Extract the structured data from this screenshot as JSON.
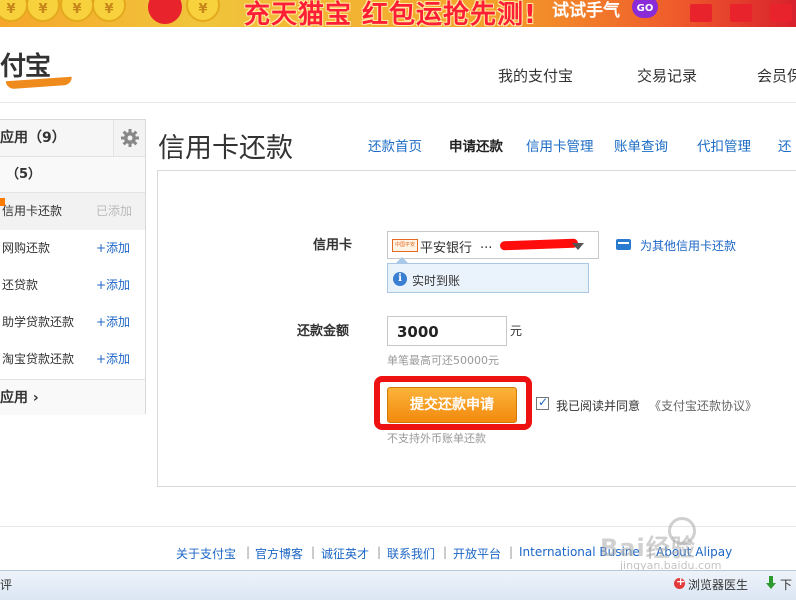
{
  "banner": {
    "headline": "充天猫宝 红包运抢先测!",
    "cta": "试试手气",
    "go": "GO"
  },
  "header": {
    "logo_text": "付宝",
    "nav": [
      "我的支付宝",
      "交易记录",
      "会员保"
    ]
  },
  "sidebar": {
    "title": "应用（9）",
    "subtitle": "（5）",
    "items": [
      {
        "label": "信用卡还款",
        "action": "已添加"
      },
      {
        "label": "网购还款",
        "action": "+添加"
      },
      {
        "label": "还贷款",
        "action": "+添加"
      },
      {
        "label": "助学贷款还款",
        "action": "+添加"
      },
      {
        "label": "淘宝贷款还款",
        "action": "+添加"
      }
    ],
    "footer": "应用"
  },
  "main": {
    "title": "信用卡还款",
    "tabs": [
      "还款首页",
      "申请还款",
      "信用卡管理",
      "账单查询",
      "代扣管理",
      "还"
    ],
    "active_tab": 1
  },
  "form": {
    "card_label": "信用卡",
    "bank_logo_text": "中国平安",
    "bank_name": "平安银行",
    "card_number": "...",
    "other_card_link": "为其他信用卡还款",
    "tip_text": "实时到账",
    "amount_label": "还款金额",
    "amount_value": "3000",
    "unit": "元",
    "limit_hint": "单笔最高可还50000元",
    "submit_label": "提交还款申请",
    "agree_text": "我已阅读并同意",
    "agree_link": "《支付宝还款协议》",
    "foreign_note": "不支持外币账单还款"
  },
  "footer": {
    "links": [
      "关于支付宝",
      "官方博客",
      "诚征英才",
      "联系我们",
      "开放平台",
      "International Busine",
      "About Alipay"
    ],
    "watermark": "Bai经验",
    "watermark_sub": "jingyan.baidu.com"
  },
  "statusbar": {
    "left": "评",
    "doctor": "浏览器医生",
    "download": "下"
  },
  "colors": {
    "link": "#1c66c6",
    "button": "#f28a0e",
    "highlight": "#ee1111"
  }
}
